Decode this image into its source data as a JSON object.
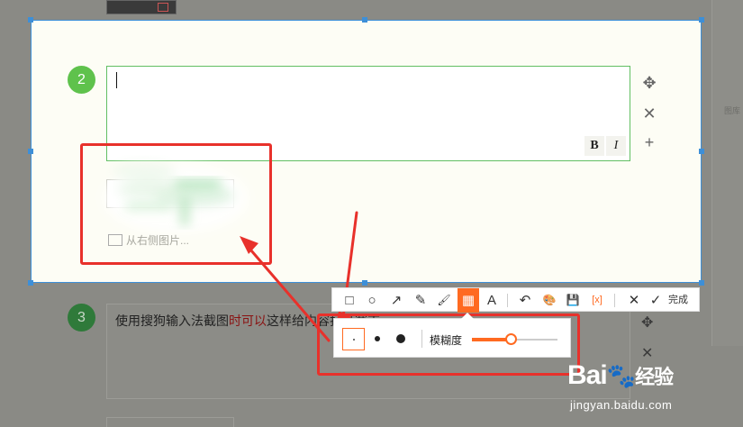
{
  "question2": {
    "number": "2",
    "format_bold": "B",
    "format_italic": "I",
    "upload_hint": "从右侧图片..."
  },
  "question3": {
    "number": "3",
    "text_part1": "使用搜狗输入法截图",
    "text_part2": "时可以",
    "text_part3": "这样给内容打马赛克"
  },
  "sidebar_text": "图库",
  "toolbar": {
    "tools": [
      {
        "name": "rectangle-icon",
        "glyph": "□"
      },
      {
        "name": "ellipse-icon",
        "glyph": "○"
      },
      {
        "name": "arrow-icon",
        "glyph": "↗"
      },
      {
        "name": "pencil-icon",
        "glyph": "✎"
      },
      {
        "name": "highlighter-icon",
        "glyph": "🖌"
      },
      {
        "name": "mosaic-icon",
        "glyph": "▦"
      },
      {
        "name": "text-icon",
        "glyph": "A"
      },
      {
        "name": "undo-icon",
        "glyph": "↶"
      },
      {
        "name": "palette-icon",
        "glyph": "🎨"
      },
      {
        "name": "save-icon",
        "glyph": "💾"
      },
      {
        "name": "ocr-icon",
        "glyph": "[x]"
      },
      {
        "name": "close-icon",
        "glyph": "✕"
      },
      {
        "name": "done-icon",
        "glyph": "✓"
      }
    ],
    "done_label": "完成",
    "active_tool": "mosaic-icon"
  },
  "mosaic_panel": {
    "blur_label": "模糊度",
    "blur_level": 0.45
  },
  "watermark": {
    "brand": "Bai",
    "brand_cn": "经验",
    "site": "jingyan.baidu.com"
  },
  "colors": {
    "accent": "#ff6a21",
    "annotation_red": "#e8312b",
    "selection_blue": "#3d8fd8",
    "step_green": "#5fc24c"
  }
}
